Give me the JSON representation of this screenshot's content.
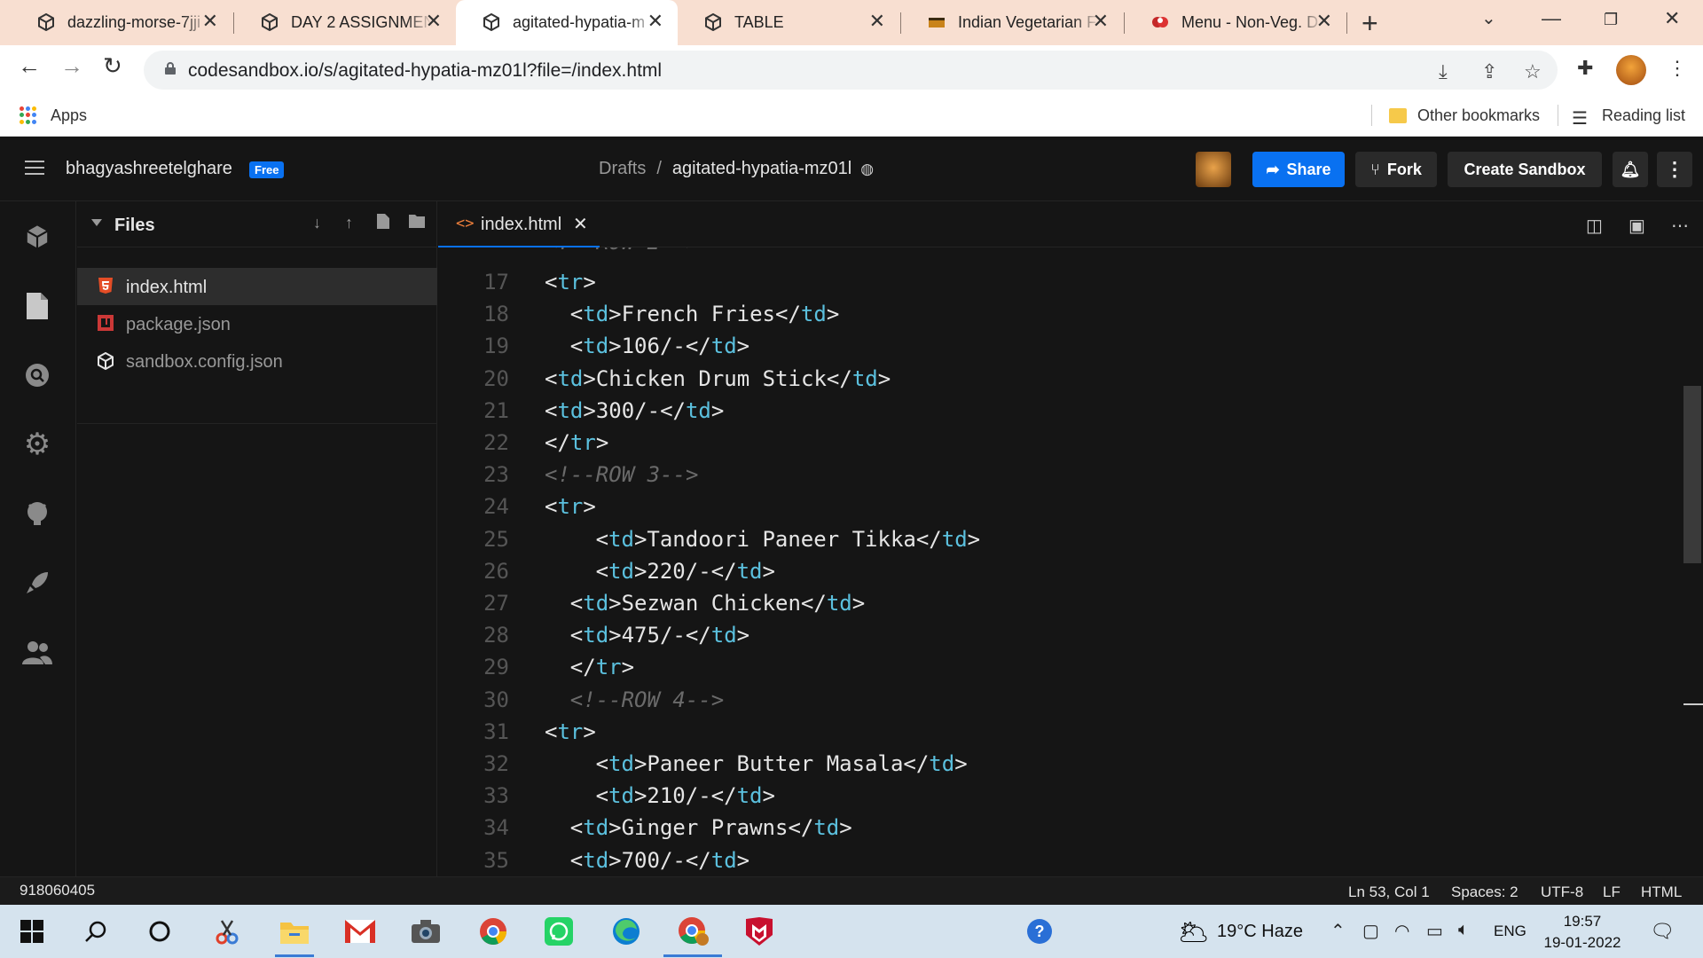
{
  "browser": {
    "tabs": [
      {
        "title": "dazzling-morse-7jji",
        "icon": "codesandbox-icon"
      },
      {
        "title": "DAY 2 ASSIGNMEN",
        "icon": "codesandbox-icon"
      },
      {
        "title": "agitated-hypatia-m",
        "icon": "codesandbox-icon",
        "active": true
      },
      {
        "title": "TABLE",
        "icon": "codesandbox-icon"
      },
      {
        "title": "Indian Vegetarian F",
        "icon": "restaurant-icon"
      },
      {
        "title": "Menu - Non-Veg. D",
        "icon": "restaurant-logo-icon"
      }
    ],
    "close_glyph": "✕",
    "new_tab": "+",
    "url": "codesandbox.io/s/agitated-hypatia-mz01l?file=/index.html",
    "bookmarks": {
      "apps_label": "Apps",
      "other_label": "Other bookmarks",
      "reading_list_label": "Reading list"
    }
  },
  "codesandbox": {
    "username": "bhagyashreetelghare",
    "plan_badge": "Free",
    "breadcrumb_root": "Drafts",
    "breadcrumb_sep": "/",
    "sandbox_name": "agitated-hypatia-mz01l",
    "share_label": "Share",
    "fork_label": "Fork",
    "create_label": "Create Sandbox",
    "accent_color": "#0971f1"
  },
  "explorer": {
    "title": "Files",
    "files": [
      {
        "name": "index.html",
        "icon": "html-file-icon"
      },
      {
        "name": "package.json",
        "icon": "npm-file-icon"
      },
      {
        "name": "sandbox.config.json",
        "icon": "sandbox-config-icon"
      }
    ]
  },
  "editor": {
    "tab_name": "index.html",
    "tab_close": "✕",
    "lines": [
      {
        "num": "17",
        "indent": 0,
        "parts": [
          [
            "tag",
            "<tr>"
          ]
        ]
      },
      {
        "num": "18",
        "indent": 1,
        "parts": [
          [
            "tag",
            "<td>"
          ],
          [
            "text",
            "French Fries"
          ],
          [
            "tag",
            "</td>"
          ]
        ]
      },
      {
        "num": "19",
        "indent": 1,
        "parts": [
          [
            "tag",
            "<td>"
          ],
          [
            "text",
            "106/-"
          ],
          [
            "tag",
            "</td>"
          ]
        ]
      },
      {
        "num": "20",
        "indent": 0,
        "parts": [
          [
            "tag",
            "<td>"
          ],
          [
            "text",
            "Chicken Drum Stick"
          ],
          [
            "tag",
            "</td>"
          ]
        ]
      },
      {
        "num": "21",
        "indent": 0,
        "parts": [
          [
            "tag",
            "<td>"
          ],
          [
            "text",
            "300/-"
          ],
          [
            "tag",
            "</td>"
          ]
        ]
      },
      {
        "num": "22",
        "indent": 0,
        "parts": [
          [
            "tag",
            "</tr>"
          ]
        ]
      },
      {
        "num": "23",
        "indent": 0,
        "parts": [
          [
            "comment",
            "<!--ROW 3-->"
          ]
        ]
      },
      {
        "num": "24",
        "indent": 0,
        "parts": [
          [
            "tag",
            "<tr>"
          ]
        ]
      },
      {
        "num": "25",
        "indent": 2,
        "parts": [
          [
            "tag",
            "<td>"
          ],
          [
            "text",
            "Tandoori Paneer Tikka"
          ],
          [
            "tag",
            "</td>"
          ]
        ]
      },
      {
        "num": "26",
        "indent": 2,
        "parts": [
          [
            "tag",
            "<td>"
          ],
          [
            "text",
            "220/-"
          ],
          [
            "tag",
            "</td>"
          ]
        ]
      },
      {
        "num": "27",
        "indent": 1,
        "parts": [
          [
            "tag",
            "<td>"
          ],
          [
            "text",
            "Sezwan Chicken"
          ],
          [
            "tag",
            "</td>"
          ]
        ]
      },
      {
        "num": "28",
        "indent": 1,
        "parts": [
          [
            "tag",
            "<td>"
          ],
          [
            "text",
            "475/-"
          ],
          [
            "tag",
            "</td>"
          ]
        ]
      },
      {
        "num": "29",
        "indent": 1,
        "parts": [
          [
            "tag",
            "</tr>"
          ]
        ]
      },
      {
        "num": "30",
        "indent": 1,
        "parts": [
          [
            "comment",
            "<!--ROW 4-->"
          ]
        ]
      },
      {
        "num": "31",
        "indent": 0,
        "parts": [
          [
            "tag",
            "<tr>"
          ]
        ]
      },
      {
        "num": "32",
        "indent": 2,
        "parts": [
          [
            "tag",
            "<td>"
          ],
          [
            "text",
            "Paneer Butter Masala"
          ],
          [
            "tag",
            "</td>"
          ]
        ]
      },
      {
        "num": "33",
        "indent": 2,
        "parts": [
          [
            "tag",
            "<td>"
          ],
          [
            "text",
            "210/-"
          ],
          [
            "tag",
            "</td>"
          ]
        ]
      },
      {
        "num": "34",
        "indent": 1,
        "parts": [
          [
            "tag",
            "<td>"
          ],
          [
            "text",
            "Ginger Prawns"
          ],
          [
            "tag",
            "</td>"
          ]
        ]
      },
      {
        "num": "35",
        "indent": 1,
        "parts": [
          [
            "tag",
            "<td>"
          ],
          [
            "text",
            "700/-"
          ],
          [
            "tag",
            "</td>"
          ]
        ]
      }
    ]
  },
  "status": {
    "left_text": "918060405",
    "position": "Ln 53, Col 1",
    "spaces": "Spaces: 2",
    "encoding": "UTF-8",
    "eol": "LF",
    "language": "HTML"
  },
  "taskbar": {
    "temperature": "19°C",
    "weather": "Haze",
    "language": "ENG",
    "time": "19:57",
    "date": "19-01-2022"
  }
}
